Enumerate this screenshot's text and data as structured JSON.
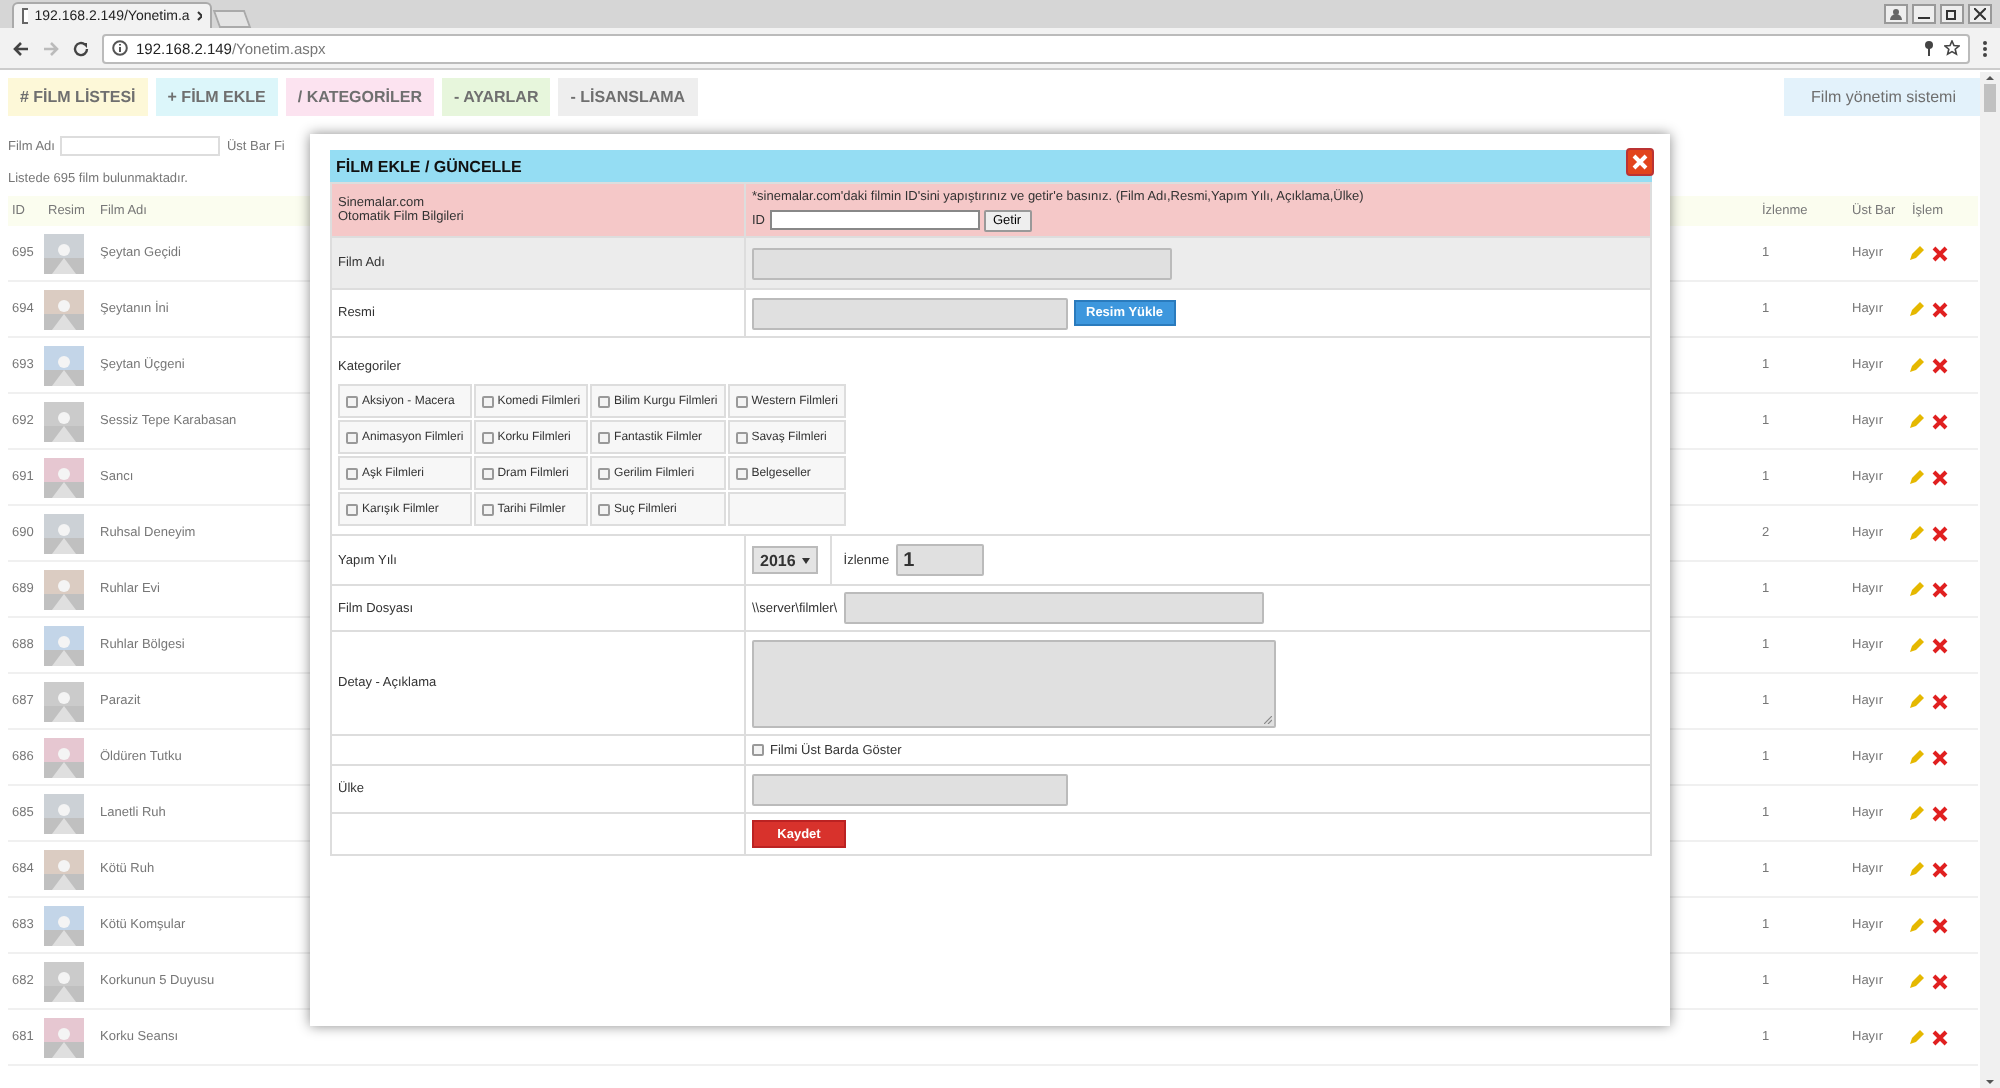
{
  "browser": {
    "tab_title": "192.168.2.149/Yonetim.a",
    "url_host": "192.168.2.149",
    "url_path": "/Yonetim.aspx"
  },
  "nav": [
    {
      "label": "# FİLM LİSTESİ",
      "color": "#fdf8d8"
    },
    {
      "label": "+ FİLM EKLE",
      "color": "#dcf6fa"
    },
    {
      "label": "/ KATEGORİLER",
      "color": "#fce3f0"
    },
    {
      "label": "- AYARLAR",
      "color": "#e7f6dc"
    },
    {
      "label": "- LİSANSLAMA",
      "color": "#eeeeee"
    }
  ],
  "site_title": "Film yönetim sistemi",
  "filters": {
    "film_label": "Film Adı",
    "topbar_label": "Üst Bar Fi"
  },
  "count_text": "Listede 695 film bulunmaktadır.",
  "table": {
    "columns": [
      "ID",
      "Resim",
      "Film Adı",
      "İzlenme",
      "Üst Bar",
      "İşlem"
    ],
    "rows": [
      {
        "id": "695",
        "name": "Şeytan Geçidi",
        "views": "1",
        "topbar": "Hayır"
      },
      {
        "id": "694",
        "name": "Şeytanın İni",
        "views": "1",
        "topbar": "Hayır"
      },
      {
        "id": "693",
        "name": "Şeytan Üçgeni",
        "views": "1",
        "topbar": "Hayır"
      },
      {
        "id": "692",
        "name": "Sessiz Tepe Karabasan",
        "views": "1",
        "topbar": "Hayır"
      },
      {
        "id": "691",
        "name": "Sancı",
        "views": "1",
        "topbar": "Hayır"
      },
      {
        "id": "690",
        "name": "Ruhsal Deneyim",
        "views": "2",
        "topbar": "Hayır"
      },
      {
        "id": "689",
        "name": "Ruhlar Evi",
        "views": "1",
        "topbar": "Hayır"
      },
      {
        "id": "688",
        "name": "Ruhlar Bölgesi",
        "views": "1",
        "topbar": "Hayır"
      },
      {
        "id": "687",
        "name": "Parazit",
        "views": "1",
        "topbar": "Hayır"
      },
      {
        "id": "686",
        "name": "Öldüren Tutku",
        "views": "1",
        "topbar": "Hayır"
      },
      {
        "id": "685",
        "name": "Lanetli Ruh",
        "views": "1",
        "topbar": "Hayır"
      },
      {
        "id": "684",
        "name": "Kötü Ruh",
        "views": "1",
        "topbar": "Hayır"
      },
      {
        "id": "683",
        "name": "Kötü Komşular",
        "views": "1",
        "topbar": "Hayır"
      },
      {
        "id": "682",
        "name": "Korkunun 5 Duyusu",
        "views": "1",
        "topbar": "Hayır"
      },
      {
        "id": "681",
        "name": "Korku Seansı",
        "views": "1",
        "topbar": "Hayır"
      }
    ]
  },
  "modal": {
    "title": "FİLM EKLE / GÜNCELLE",
    "auto": {
      "label_1": "Sinemalar.com",
      "label_2": "Otomatik Film Bilgileri",
      "hint": "*sinemalar.com'daki filmin ID'sini yapıştırınız ve getir'e basınız. (Film Adı,Resmi,Yapım Yılı, Açıklama,Ülke)",
      "id_label": "ID",
      "button": "Getir"
    },
    "film_name_label": "Film Adı",
    "image_label": "Resmi",
    "upload_button": "Resim Yükle",
    "categories_label": "Kategoriler",
    "categories": [
      {
        "label": "Aksiyon - Macera",
        "checked": false
      },
      {
        "label": "Komedi Filmleri",
        "checked": false
      },
      {
        "label": "Bilim Kurgu Filmleri",
        "checked": false
      },
      {
        "label": "Western Filmleri",
        "checked": false
      },
      {
        "label": "Animasyon Filmleri",
        "checked": false
      },
      {
        "label": "Korku Filmleri",
        "checked": false
      },
      {
        "label": "Fantastik Filmler",
        "checked": false
      },
      {
        "label": "Savaş Filmleri",
        "checked": false
      },
      {
        "label": "Aşk Filmleri",
        "checked": false
      },
      {
        "label": "Dram Filmleri",
        "checked": false
      },
      {
        "label": "Gerilim Filmleri",
        "checked": false
      },
      {
        "label": "Belgeseller",
        "checked": false
      },
      {
        "label": "Karışık Filmler",
        "checked": false
      },
      {
        "label": "Tarihi Filmler",
        "checked": false
      },
      {
        "label": "Suç Filmleri",
        "checked": false
      }
    ],
    "year_label": "Yapım Yılı",
    "year_value": "2016",
    "views_label": "İzlenme",
    "views_value": "1",
    "file_label": "Film Dosyası",
    "file_prefix": "\\\\server\\filmler\\",
    "detail_label": "Detay - Açıklama",
    "topbar_check": {
      "label": "Filmi Üst Barda Göster",
      "checked": false
    },
    "country_label": "Ülke",
    "save_button": "Kaydet"
  }
}
